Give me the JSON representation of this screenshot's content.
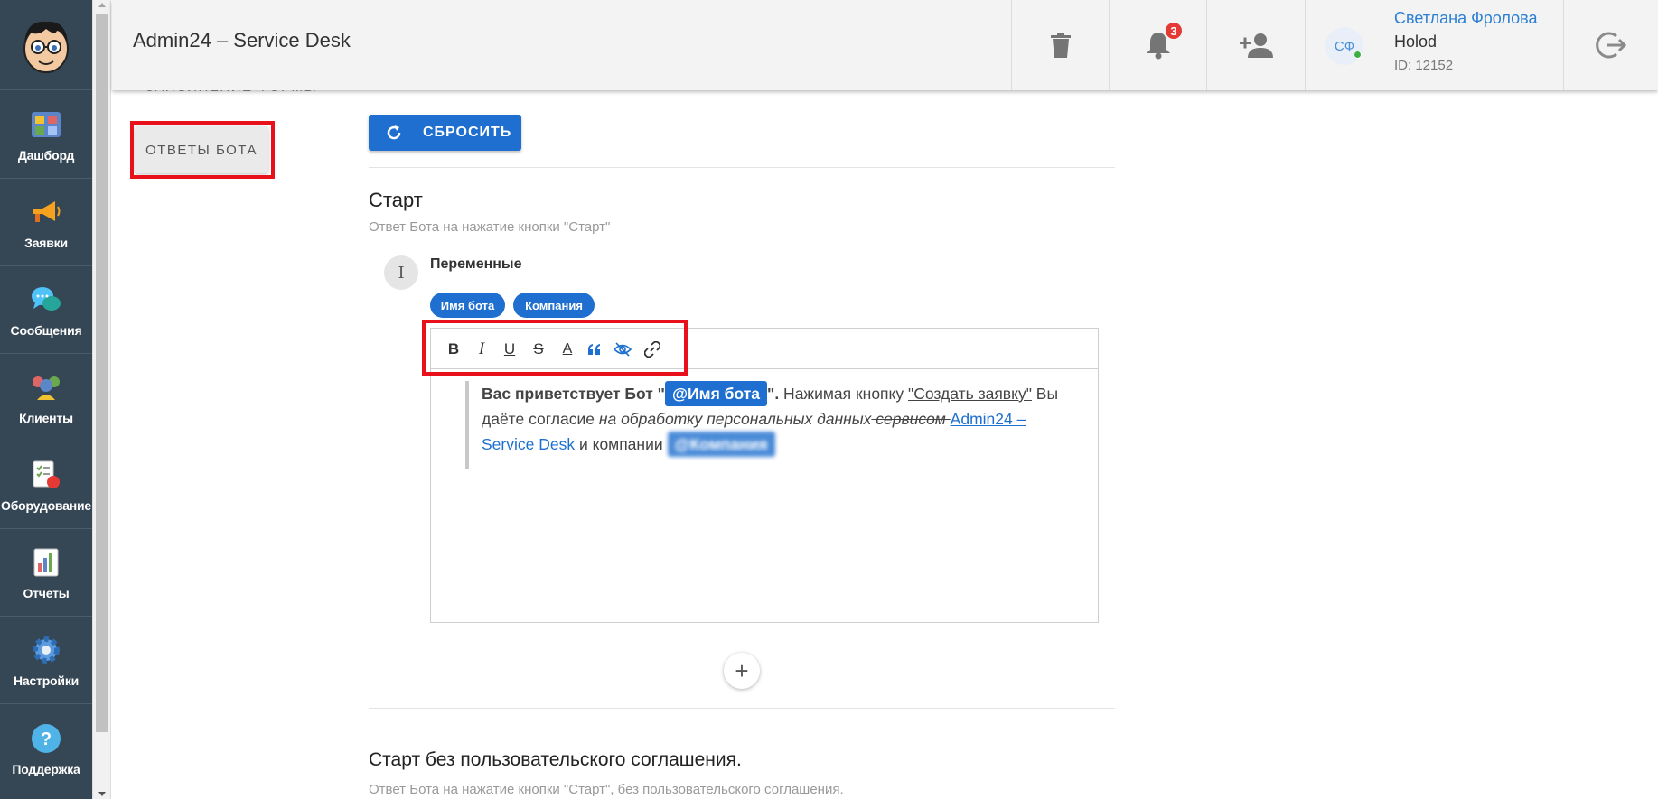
{
  "header": {
    "title": "Admin24 – Service Desk",
    "notifications_count": "3",
    "user": {
      "initials": "СФ",
      "name": "Светлана Фролова",
      "org": "Holod",
      "id": "ID: 12152"
    }
  },
  "sidebar": {
    "items": [
      {
        "label": "Дашборд",
        "icon": "dashboard-icon"
      },
      {
        "label": "Заявки",
        "icon": "megaphone-icon"
      },
      {
        "label": "Сообщения",
        "icon": "chat-bubbles-icon"
      },
      {
        "label": "Клиенты",
        "icon": "clients-icon"
      },
      {
        "label": "Оборудование",
        "icon": "equipment-checklist-icon"
      },
      {
        "label": "Отчеты",
        "icon": "reports-icon"
      },
      {
        "label": "Настройки",
        "icon": "gear-icon"
      },
      {
        "label": "Поддержка",
        "icon": "help-icon"
      }
    ]
  },
  "main": {
    "cut_off_heading": "ЗАПОЛНЕНИЕ ФОРМЫ",
    "tab_bot_answers": "ОТВЕТЫ БОТА",
    "reset_label": "СБРОСИТЬ",
    "sections": [
      {
        "title": "Старт",
        "subtitle": "Ответ Бота на нажатие кнопки \"Старт\""
      },
      {
        "title": "Старт без пользовательского соглашения.",
        "subtitle": "Ответ Бота на нажатие кнопки \"Старт\", без пользовательского соглашения."
      }
    ],
    "variables_label": "Переменные",
    "variables": [
      "Имя бота",
      "Компания"
    ],
    "editor": {
      "part1_bold": "Вас приветствует Бот \"",
      "var1": "@Имя бота",
      "part2_bold": "\".",
      "part3": " Нажимая кнопку ",
      "part4_underlined": "\"Создать заявку\"",
      "part5": " Вы даёте согласие ",
      "part6_italic": "на обработку персональных данных",
      "part7_strike": " сервисом ",
      "link_text": "Admin24 – Service Desk ",
      "part8": "и компании ",
      "var2": "@Компания"
    }
  },
  "colors": {
    "accent": "#1e6fcf",
    "sidebar": "#354654",
    "highlight": "#e8101b",
    "badge": "#e53935"
  }
}
